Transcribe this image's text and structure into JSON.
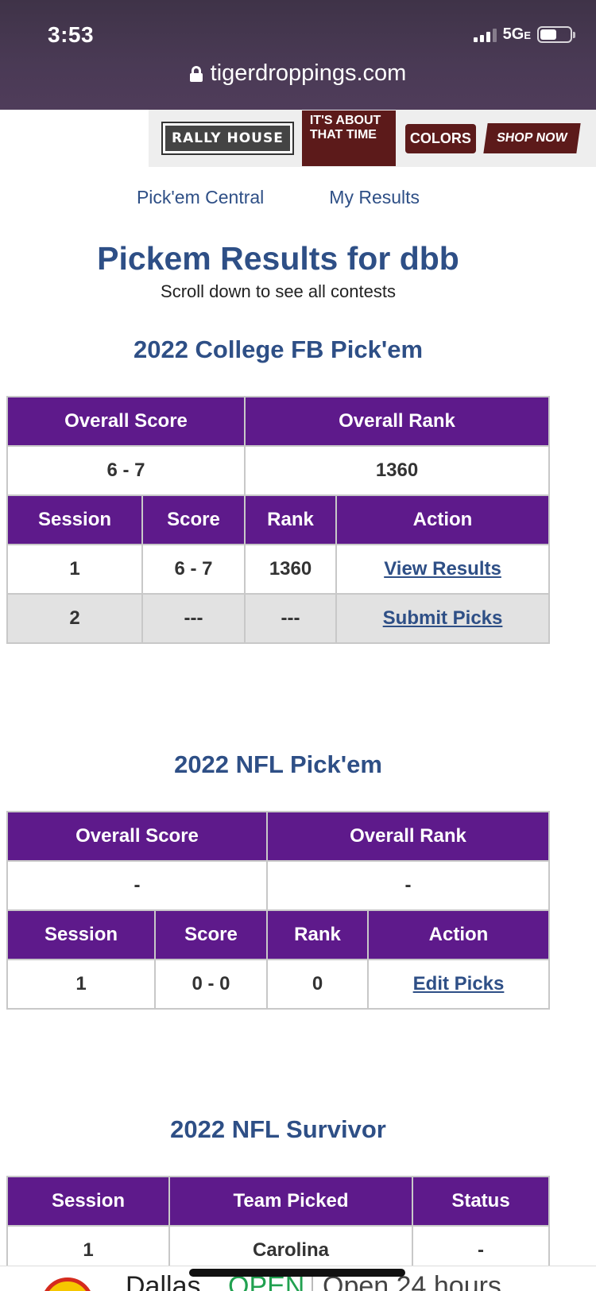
{
  "status_bar": {
    "time": "3:53",
    "network": "5G",
    "network_suffix": "E"
  },
  "browser": {
    "url": "tigerdroppings.com"
  },
  "ad": {
    "rally_house": "RALLY HOUSE",
    "about_time": "IT'S ABOUT THAT TIME",
    "college_colors": "COLORS",
    "shop_now": "SHOP NOW"
  },
  "nav": {
    "pickem_central": "Pick'em Central",
    "my_results": "My Results"
  },
  "page": {
    "title": "Pickem Results for dbb",
    "subtitle": "Scroll down to see all contests"
  },
  "contests": {
    "cfb": {
      "title": "2022 College FB Pick'em",
      "overall_headers": [
        "Overall Score",
        "Overall Rank"
      ],
      "overall_values": [
        "6 - 7",
        "1360"
      ],
      "session_headers": [
        "Session",
        "Score",
        "Rank",
        "Action"
      ],
      "rows": [
        {
          "session": "1",
          "score": "6 - 7",
          "rank": "1360",
          "action": "View Results"
        },
        {
          "session": "2",
          "score": "---",
          "rank": "---",
          "action": "Submit Picks"
        }
      ]
    },
    "nfl": {
      "title": "2022 NFL Pick'em",
      "overall_headers": [
        "Overall Score",
        "Overall Rank"
      ],
      "overall_values": [
        "-",
        "-"
      ],
      "session_headers": [
        "Session",
        "Score",
        "Rank",
        "Action"
      ],
      "rows": [
        {
          "session": "1",
          "score": "0 - 0",
          "rank": "0",
          "action": "Edit Picks"
        }
      ]
    },
    "survivor": {
      "title": "2022 NFL Survivor",
      "headers": [
        "Session",
        "Team Picked",
        "Status"
      ],
      "rows": [
        {
          "session": "1",
          "team": "Carolina",
          "status": "-"
        }
      ]
    }
  },
  "bottom_bar": {
    "city": "Dallas",
    "open": "OPEN",
    "hours": "Open 24 hours"
  },
  "colors": {
    "header_purple": "#5e1a8b",
    "link_blue": "#2e4f86"
  }
}
